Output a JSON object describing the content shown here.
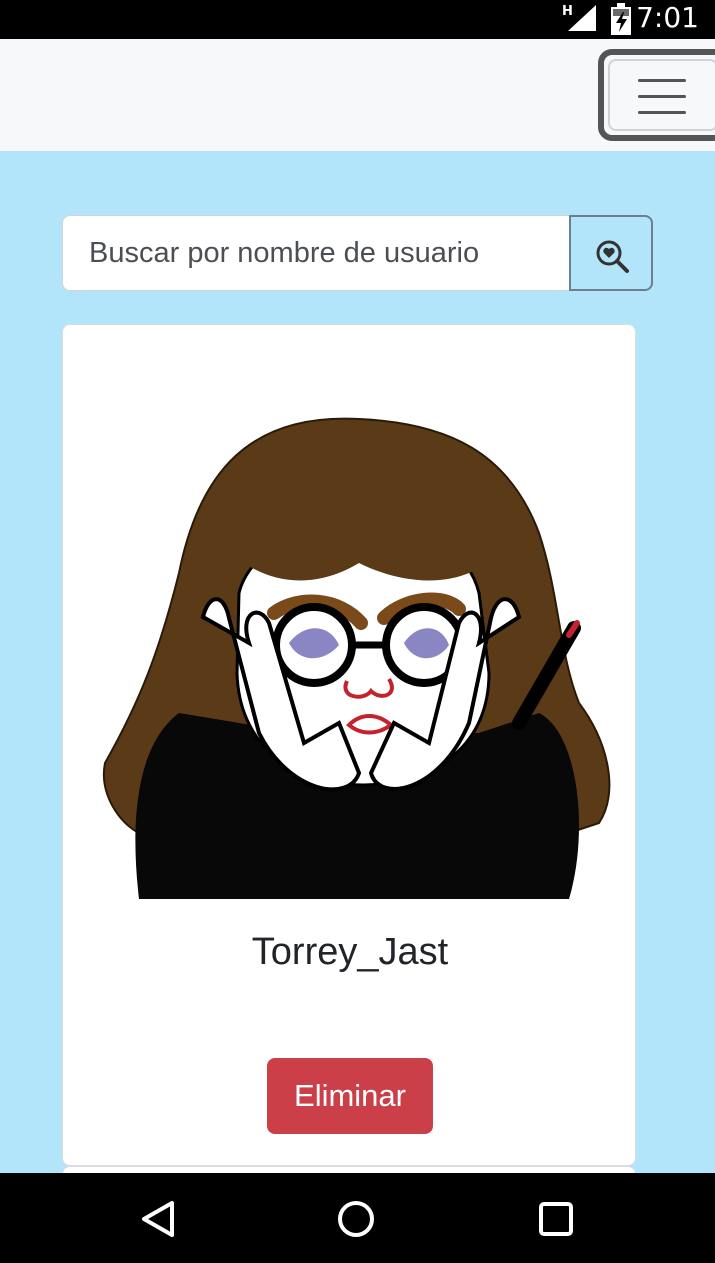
{
  "status_bar": {
    "time": "7:01",
    "network_badge": "H",
    "icons": [
      "signal-icon",
      "battery-charging-icon"
    ]
  },
  "navbar": {
    "menu_icon": "hamburger-menu-icon"
  },
  "search": {
    "placeholder": "Buscar por nombre de usuario",
    "value": "",
    "button_icon": "search-heart-icon"
  },
  "users": [
    {
      "username": "Torrey_Jast",
      "avatar_icon": "avatar-illustration",
      "delete_label": "Eliminar"
    }
  ],
  "colors": {
    "background": "#b3e5fa",
    "navbar": "#f7f8fa",
    "danger": "#ca3f48",
    "hair": "#5b3a17"
  },
  "android_nav": {
    "icons": [
      "back-icon",
      "home-icon",
      "recents-icon"
    ]
  }
}
